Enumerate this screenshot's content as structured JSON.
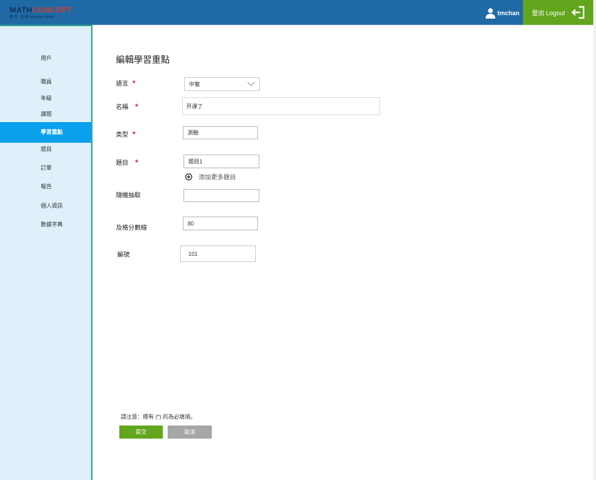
{
  "header": {
    "logo_main_a": "MATH",
    "logo_main_b": "CONCEPT",
    "logo_sub": "數 學 · 思 維  Learning Center",
    "username": "tmchan",
    "logout_label": "登出 Logout",
    "user_icon": "user-icon",
    "logout_icon": "logout-icon"
  },
  "sidebar": {
    "items": [
      {
        "label": "用戶"
      },
      {
        "label": "職員"
      },
      {
        "label": "年級"
      },
      {
        "label": "課題"
      },
      {
        "label": "學習重點"
      },
      {
        "label": "題目"
      },
      {
        "label": "訂單"
      },
      {
        "label": "報告"
      },
      {
        "label": "個人資訊"
      },
      {
        "label": "數據字典"
      }
    ],
    "active_index": 4
  },
  "form": {
    "title": "編輯學習重點",
    "language_label": "語言",
    "language_value": "中繁",
    "name_label": "名稱",
    "name_value": "开课了",
    "type_label": "类型",
    "type_value": "測驗",
    "question_label": "題目",
    "question_value": "題目1",
    "add_more_label": "添加更多題目",
    "random_label": "隨機抽取",
    "random_value": "",
    "passing_label": "及格分數線",
    "passing_value": "80",
    "number_label": "編號",
    "number_value": "101",
    "required_mark": "*",
    "note": "請注意：標有 (*) 的為必填項。",
    "submit_label": "提交",
    "cancel_label": "取消"
  },
  "colors": {
    "header_bg": "#1f6aa5",
    "logout_bg": "#62a61d",
    "sidebar_bg": "#dff0fb",
    "sidebar_active": "#0aa0ec",
    "required": "#d12020",
    "cancel_bg": "#a6a6a6"
  }
}
